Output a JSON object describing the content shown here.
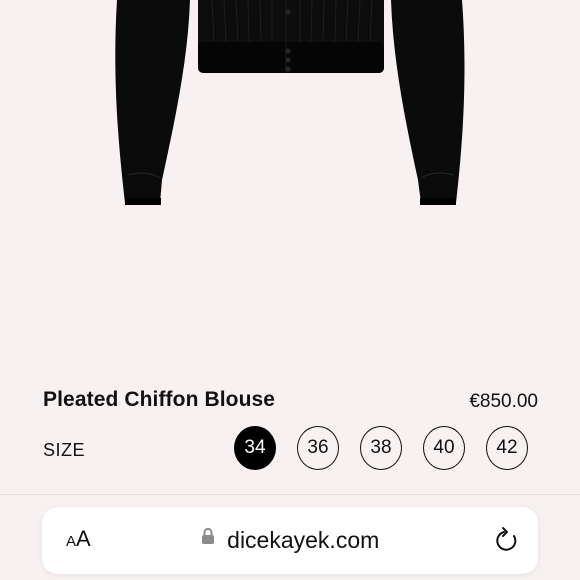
{
  "product": {
    "title": "Pleated Chiffon Blouse",
    "price": "€850.00"
  },
  "size": {
    "label": "SIZE",
    "options": [
      "34",
      "36",
      "38",
      "40",
      "42"
    ],
    "selected": "34"
  },
  "browser": {
    "text_size_small": "A",
    "text_size_big": "A",
    "url": "dicekayek.com",
    "lock_icon": "lock-icon",
    "reload_icon": "reload-icon"
  },
  "colors": {
    "background": "#f7f2f1",
    "text": "#111111",
    "selected_size_bg": "#000000",
    "address_bar_bg": "#ffffff"
  }
}
